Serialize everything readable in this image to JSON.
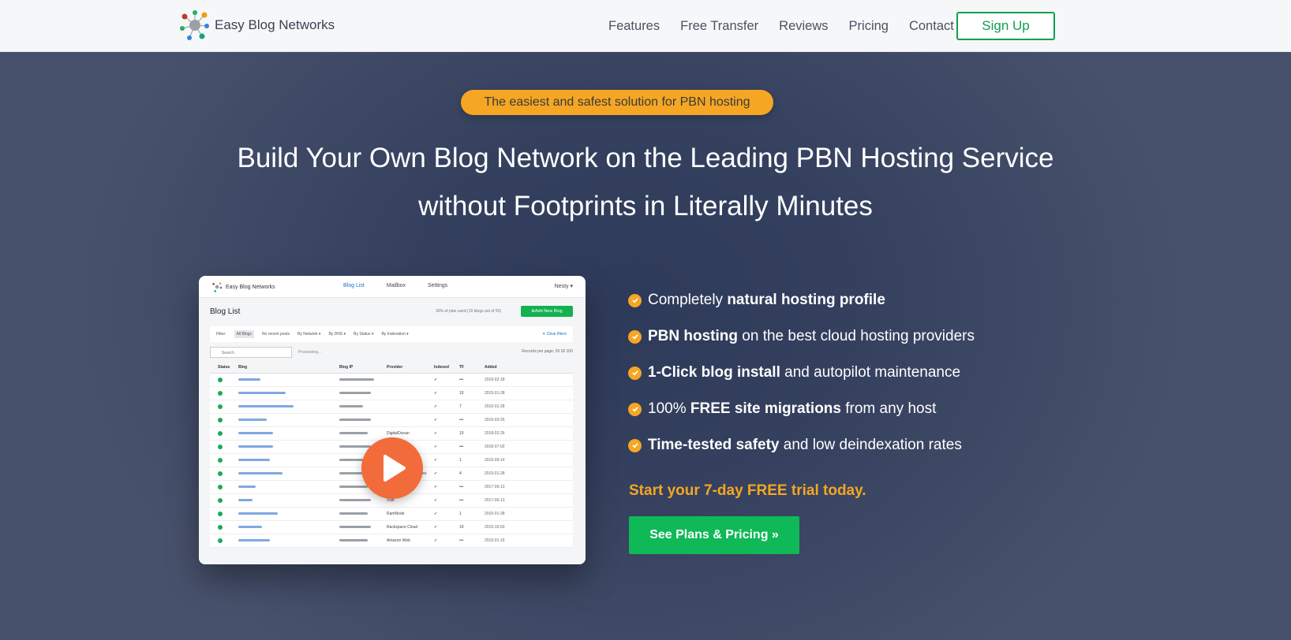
{
  "brand": {
    "name": "Easy Blog Networks"
  },
  "nav": {
    "links": [
      "Features",
      "Free Transfer",
      "Reviews",
      "Pricing",
      "Contact"
    ],
    "signup": "Sign Up"
  },
  "hero": {
    "badge": "The easiest and safest solution for PBN hosting",
    "headline_line1": "Build Your Own Blog Network on the Leading PBN Hosting Service",
    "headline_line2": "without Footprints in Literally Minutes"
  },
  "features": [
    {
      "pre": "Completely ",
      "bold": "natural hosting profile",
      "post": ""
    },
    {
      "pre": "",
      "bold": "PBN hosting",
      "post": " on the best cloud hosting providers"
    },
    {
      "pre": "",
      "bold": "1-Click blog install",
      "post": " and autopilot maintenance"
    },
    {
      "pre": "100% ",
      "bold": "FREE site migrations",
      "post": " from any host"
    },
    {
      "pre": "",
      "bold": "Time-tested safety",
      "post": " and low deindexation rates"
    }
  ],
  "trial_text": "Start your 7-day FREE trial today.",
  "cta_label": "See Plans & Pricing »",
  "preview": {
    "brand": "Easy Blog Networks",
    "tabs": [
      "Blog List",
      "Mailbox",
      "Settings"
    ],
    "user": "Nesty ▾",
    "title": "Blog List",
    "usage": "30% of plan used (15 blogs out of 50)",
    "add_button": "Add New Blog",
    "filter_label": "Filter:",
    "filters": [
      "All Blogs",
      "No recent posts",
      "By Network ▾",
      "By DNS ▾",
      "By Status ▾",
      "By Indexation ▾"
    ],
    "clear_filters": "✕ Clear filters",
    "search_placeholder": "Search",
    "processing": "Processing...",
    "records_per_page": "Records per page:  20  50  100",
    "columns": [
      "Status",
      "Blog",
      "Blog IP",
      "Provider",
      "Indexed",
      "TF",
      "Added"
    ],
    "rows": [
      {
        "provider": "",
        "tf": "•••",
        "added": "2019-02-18"
      },
      {
        "provider": "",
        "tf": "10",
        "added": "2015-01-28"
      },
      {
        "provider": "",
        "tf": "7",
        "added": "2015-01-28"
      },
      {
        "provider": "",
        "tf": "•••",
        "added": "2016-03-26"
      },
      {
        "provider": "DigitalOcean",
        "tf": "10",
        "added": "2018-02-26"
      },
      {
        "provider": "Hostwinds",
        "tf": "•••",
        "added": "2018-07-02"
      },
      {
        "provider": "UpCloud",
        "tf": "1",
        "added": "2015-09-14"
      },
      {
        "provider": "Amazon Web Services",
        "tf": "4",
        "added": "2015-01-28"
      },
      {
        "provider": "SoftLayer",
        "tf": "•••",
        "added": "2017-06-13"
      },
      {
        "provider": "Vultr",
        "tf": "•••",
        "added": "2017-06-13"
      },
      {
        "provider": "RamNode",
        "tf": "1",
        "added": "2015-01-28"
      },
      {
        "provider": "Rackspace Cloud",
        "tf": "19",
        "added": "2015-10-03"
      },
      {
        "provider": "Amazon Web",
        "tf": "•••",
        "added": "2015-01-15"
      }
    ]
  },
  "colors": {
    "accent": "#f5a623",
    "green": "#0fb957",
    "hero_bg": "#34405e",
    "play": "#f26b3a"
  }
}
